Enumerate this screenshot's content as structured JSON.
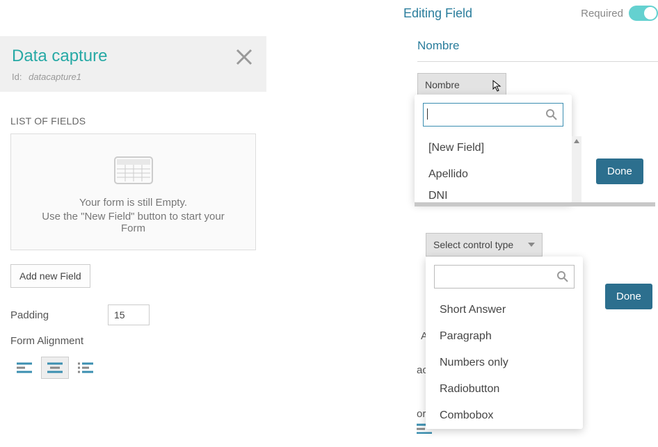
{
  "left": {
    "title": "Data capture",
    "id_label": "Id:",
    "id_value": "datacapture1",
    "list_heading": "LIST OF FIELDS",
    "empty_line1": "Your form is still Empty.",
    "empty_line2": "Use the \"New Field\" button to start your Form",
    "add_btn": "Add new Field",
    "padding_label": "Padding",
    "padding_value": "15",
    "align_label": "Form Alignment"
  },
  "right": {
    "edit_title": "Editing Field",
    "required_label": "Required",
    "required_on": true,
    "field_name": "Nombre",
    "select_current": "Nombre"
  },
  "dropdown1": {
    "search_value": "",
    "items": [
      "[New Field]",
      "Apellido",
      "DNI"
    ]
  },
  "dropdown2": {
    "button_label": "Select control type",
    "search_value": "",
    "items": [
      "Short Answer",
      "Paragraph",
      "Numbers only",
      "Radiobutton",
      "Combobox"
    ]
  },
  "side_letters": {
    "a": "A",
    "b": "ac",
    "c": "or"
  },
  "done_label": "Done"
}
